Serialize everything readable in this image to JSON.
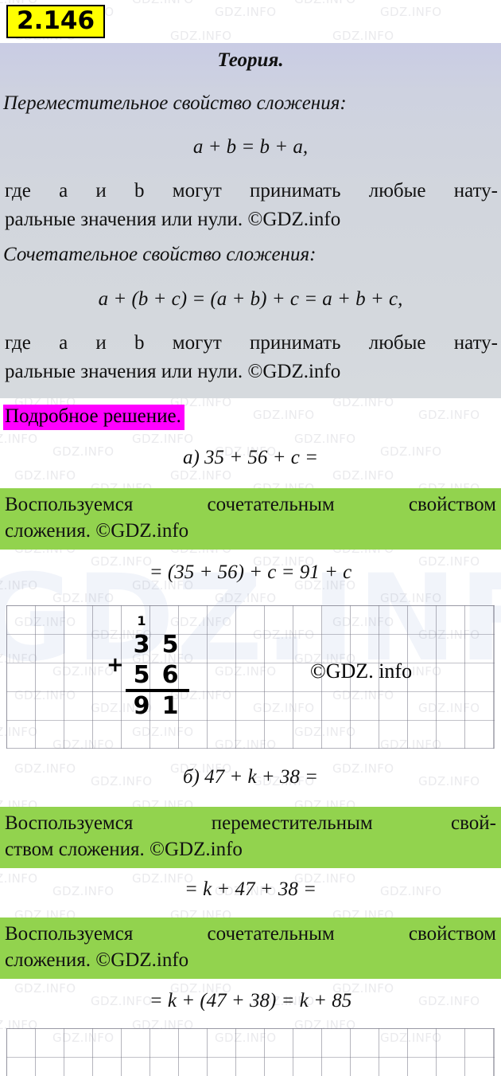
{
  "exercise": {
    "number": "2.146"
  },
  "theory": {
    "title": "Теория.",
    "prop1_heading": "Переместительное свойство сложения:",
    "prop1_formula": "a + b = b + a,",
    "prop1_note_line1": "где a и b могут принимать любые нату-",
    "prop1_note_line2": "ральные значения или нули. ©GDZ.info",
    "prop2_heading": "Сочетательное свойство сложения:",
    "prop2_formula": "a + (b + c) = (a + b) + c = a + b + c,",
    "prop2_note_line1": "где a и b могут принимать любые нату-",
    "prop2_note_line2": "ральные значения или нули. ©GDZ.info"
  },
  "solution": {
    "heading": "Подробное решение.",
    "part_a_problem": "а) 35 + 56 + c =",
    "hint_a_line1": "Воспользуемся сочетательным свойством",
    "hint_a_line2": "сложения. ©GDZ.info",
    "part_a_result": "= (35 + 56) + c = 91 + c",
    "part_b_problem": "б) 47 + k + 38 =",
    "hint_b1_line1": "Воспользуемся переместительным свой-",
    "hint_b1_line2": "ством сложения. ©GDZ.info",
    "part_b_step1": "= k + 47 + 38 =",
    "hint_b2_line1": "Воспользуемся сочетательным свойством",
    "hint_b2_line2": "сложения. ©GDZ.info",
    "part_b_result": "= k + (47 + 38) = k + 85"
  },
  "column_addition": {
    "carry": "1",
    "plus_sign": "+",
    "addend1_tens": "3",
    "addend1_ones": "5",
    "addend2_tens": "5",
    "addend2_ones": "6",
    "sum_tens": "9",
    "sum_ones": "1",
    "copyright": "©GDZ. info"
  },
  "watermark": {
    "text": "GDZ.INFO",
    "big_text": "GDZ.INFO"
  },
  "colors": {
    "highlight_magenta": "#ff00ff",
    "highlight_green": "#92d34e",
    "number_badge": "#ffff00",
    "theory_bg_top": "#c9cce4",
    "theory_bg_bottom": "#d6dade"
  }
}
